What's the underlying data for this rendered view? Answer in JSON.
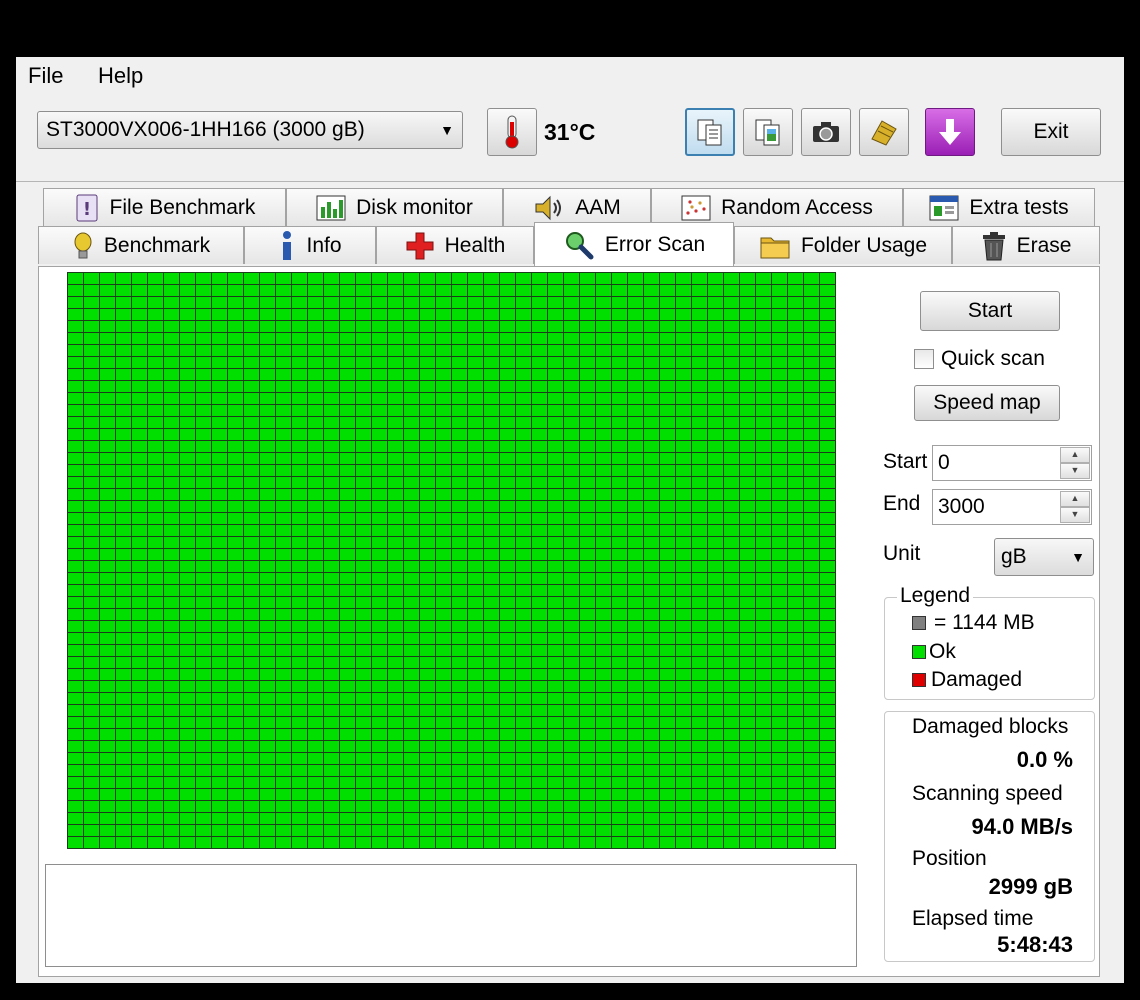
{
  "menu": {
    "file": "File",
    "help": "Help"
  },
  "toolbar": {
    "drive": "ST3000VX006-1HH166 (3000 gB)",
    "temperature": "31°C",
    "exit_label": "Exit"
  },
  "tabs": {
    "row1": [
      "File Benchmark",
      "Disk monitor",
      "AAM",
      "Random Access",
      "Extra tests"
    ],
    "row2": [
      "Benchmark",
      "Info",
      "Health",
      "Error Scan",
      "Folder Usage",
      "Erase"
    ],
    "selected": "Error Scan"
  },
  "scan": {
    "start_button": "Start",
    "quick_scan_label": "Quick scan",
    "quick_scan_checked": false,
    "speed_map_button": "Speed map",
    "start_label": "Start",
    "start_value": "0",
    "end_label": "End",
    "end_value": "3000",
    "unit_label": "Unit",
    "unit_value": "gB",
    "grid_color": "#00df00"
  },
  "legend": {
    "title": "Legend",
    "block_size": "= 1144 MB",
    "ok": "Ok",
    "damaged": "Damaged",
    "colors": {
      "block": "#808080",
      "ok": "#00df00",
      "damaged": "#e00000"
    }
  },
  "stats": {
    "damaged_blocks_label": "Damaged blocks",
    "damaged_blocks_value": "0.0 %",
    "scanning_speed_label": "Scanning speed",
    "scanning_speed_value": "94.0 MB/s",
    "position_label": "Position",
    "position_value": "2999 gB",
    "elapsed_label": "Elapsed time",
    "elapsed_value": "5:48:43"
  }
}
